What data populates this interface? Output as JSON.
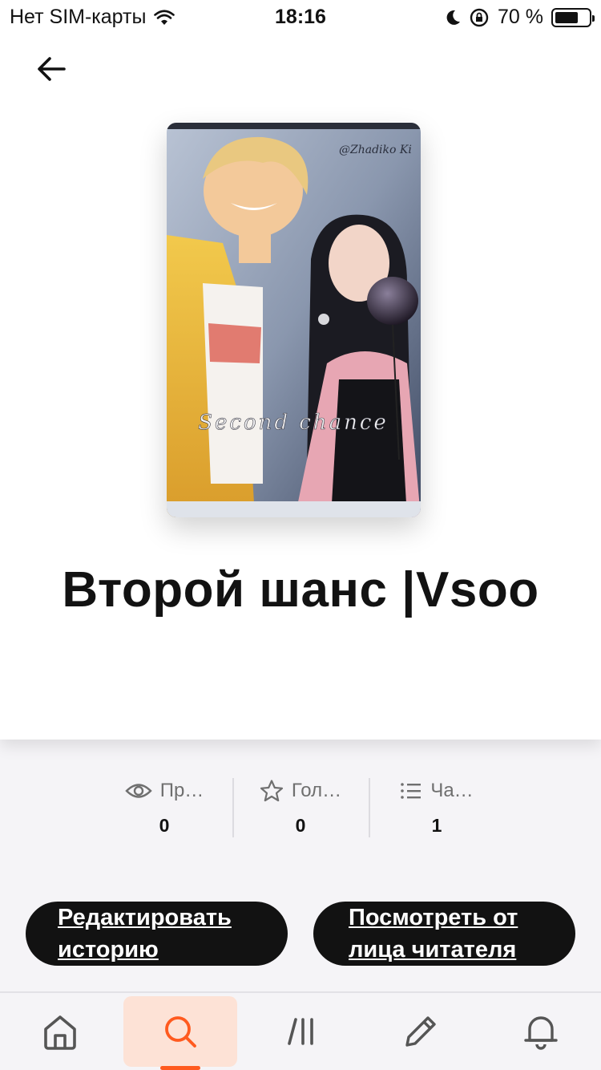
{
  "status_bar": {
    "carrier": "Нет SIM-карты",
    "time": "18:16",
    "battery": "70 %",
    "battery_level": 0.7
  },
  "header": {
    "back_icon": "arrow-left-icon"
  },
  "story": {
    "cover_text": "Second chance",
    "cover_watermark": "@Zhadiko Ki",
    "title": "Второй шанс |Vsoo"
  },
  "stats": [
    {
      "icon": "eye-icon",
      "label": "Пр…",
      "value": "0"
    },
    {
      "icon": "star-icon",
      "label": "Гол…",
      "value": "0"
    },
    {
      "icon": "list-icon",
      "label": "Ча…",
      "value": "1"
    }
  ],
  "actions": {
    "edit_label": "Редактировать историю",
    "reader_view_label": "Посмотреть от лица читателя"
  },
  "bottom_nav": {
    "items": [
      "home-icon",
      "search-icon",
      "library-icon",
      "write-icon",
      "bell-icon"
    ],
    "active": "search-icon",
    "accent_color": "#ff5a1f",
    "active_bg": "#fde2d6"
  }
}
